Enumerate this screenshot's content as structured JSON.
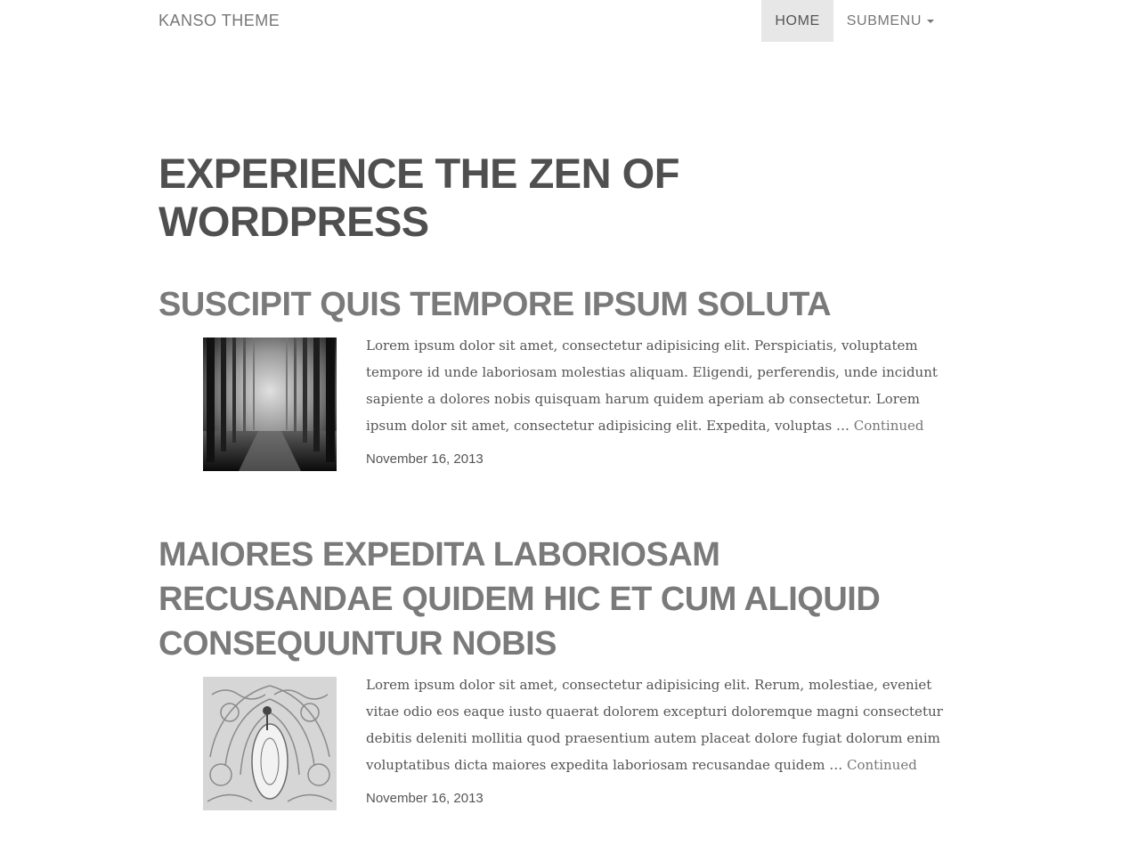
{
  "header": {
    "brand": "KANSO THEME",
    "nav": [
      {
        "label": "HOME",
        "active": true
      },
      {
        "label": "SUBMENU",
        "active": false,
        "has_caret": true
      }
    ]
  },
  "main": {
    "page_title": "EXPERIENCE THE ZEN OF WORDPRESS",
    "posts": [
      {
        "title": "SUSCIPIT QUIS TEMPORE IPSUM SOLUTA",
        "excerpt": "Lorem ipsum dolor sit amet, consectetur adipisicing elit. Perspiciatis, voluptatem tempore id unde laboriosam molestias aliquam. Eligendi, perferendis, unde incidunt sapiente a dolores nobis quisquam harum quidem aperiam ab consectetur. Lorem ipsum dolor sit amet, consectetur adipisicing elit. Expedita, voluptas … ",
        "more_link": "Continued",
        "date": "November 16, 2013",
        "thumbnail_icon": "forest-image"
      },
      {
        "title": "MAIORES EXPEDITA LABORIOSAM RECUSANDAE QUIDEM HIC ET CUM ALIQUID CONSEQUUNTUR NOBIS",
        "excerpt": "Lorem ipsum dolor sit amet, consectetur adipisicing elit. Rerum, molestiae, eveniet vitae odio eos eaque iusto quaerat dolorem excepturi doloremque magni consectetur debitis deleniti mollitia quod praesentium autem placeat dolore fugiat dolorum enim voluptatibus dicta maiores expedita laboriosam recusandae quidem … ",
        "more_link": "Continued",
        "date": "November 16, 2013",
        "thumbnail_icon": "ornate-art-image"
      }
    ]
  },
  "colors": {
    "nav_active_bg": "#e7e7e7",
    "page_title": "#4f4f4f",
    "post_title": "#7a7a7a",
    "text": "#555555"
  }
}
